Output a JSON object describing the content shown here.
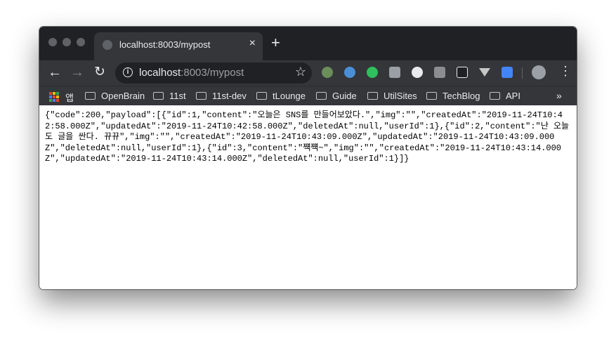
{
  "window": {
    "tab_title": "localhost:8003/mypost",
    "tab_close": "×",
    "new_tab": "+"
  },
  "toolbar": {
    "back": "←",
    "forward": "→",
    "reload": "↻",
    "url_host": "localhost",
    "url_path": ":8003/mypost",
    "star": "☆",
    "menu": "⋮"
  },
  "bookmarks": {
    "apps_label": "앱",
    "items": [
      "OpenBrain",
      "11st",
      "11st-dev",
      "tLounge",
      "Guide",
      "UtilSites",
      "TechBlog",
      "API"
    ],
    "more": "»"
  },
  "icons": {
    "apps": "apps-grid-icon",
    "folder": "folder-icon",
    "info": "info-icon",
    "star": "star-icon"
  },
  "colors": {
    "frame": "#202124",
    "toolbar": "#35363a",
    "text_light": "#e8eaed"
  },
  "page": {
    "json_text": "{\"code\":200,\"payload\":[{\"id\":1,\"content\":\"오늘은 SNS를 만들어보았다.\",\"img\":\"\",\"createdAt\":\"2019-11-24T10:42:58.000Z\",\"updatedAt\":\"2019-11-24T10:42:58.000Z\",\"deletedAt\":null,\"userId\":1},{\"id\":2,\"content\":\"난 오늘도 글을 싼다. 뀨뀨\",\"img\":\"\",\"createdAt\":\"2019-11-24T10:43:09.000Z\",\"updatedAt\":\"2019-11-24T10:43:09.000Z\",\"deletedAt\":null,\"userId\":1},{\"id\":3,\"content\":\"쨱쨱~\",\"img\":\"\",\"createdAt\":\"2019-11-24T10:43:14.000Z\",\"updatedAt\":\"2019-11-24T10:43:14.000Z\",\"deletedAt\":null,\"userId\":1}]}"
  }
}
